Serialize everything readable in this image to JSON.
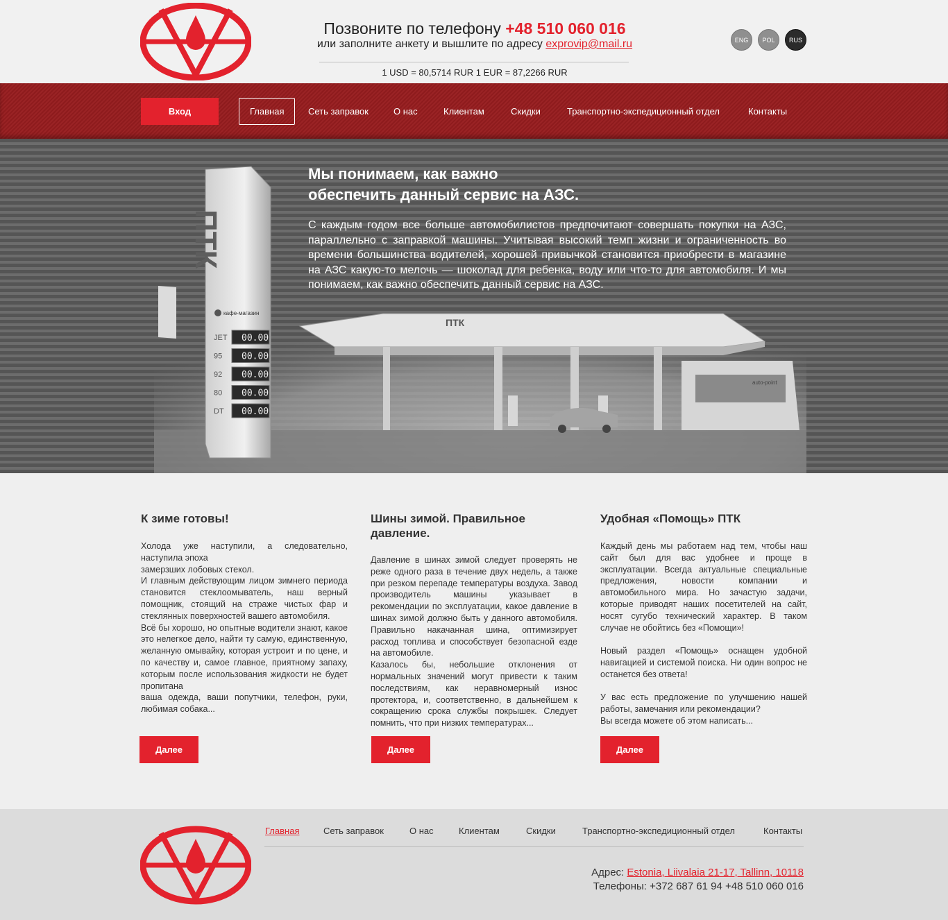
{
  "header": {
    "phone_prefix": "Позвоните по телефону",
    "phone": "+48 510 060 016",
    "mail_prefix": "или заполните анкету и вышлите по адресу",
    "email": "exprovip@mail.ru",
    "rates": "1 USD = 80,5714 RUR 1 EUR = 87,2266 RUR",
    "languages": [
      "ENG",
      "POL",
      "RUS"
    ]
  },
  "nav": {
    "login": "Вход",
    "items": [
      "Главная",
      "Сеть заправок",
      "О нас",
      "Клиентам",
      "Скидки",
      "Транспортно-экспедиционный отдел",
      "Контакты"
    ]
  },
  "hero": {
    "title": "Мы понимаем, как важно\nобеспечить данный сервис на АЗС.",
    "text": "С каждым годом все больше автомобилистов предпочитают совершать покупки на АЗС, параллельно с заправкой машины. Учитывая высокий темп жизни и ограниченность во времени большинства водителей, хорошей привычкой становится приобрести в магазине на АЗС какую-то мелочь — шоколад для ребенка, воду или что-то для автомобиля. И мы понимаем, как важно обеспечить данный сервис на АЗС.",
    "pylon": {
      "brand": "ПТК",
      "cafe": "кафе-магазин",
      "prices": [
        {
          "grade": "JET",
          "price": "00.00"
        },
        {
          "grade": "95",
          "price": "00.00"
        },
        {
          "grade": "92",
          "price": "00.00"
        },
        {
          "grade": "80",
          "price": "00.00"
        },
        {
          "grade": "DT",
          "price": "00.00"
        }
      ]
    },
    "canopy_brand": "ПТК",
    "shop_sign": "auto-point"
  },
  "articles": [
    {
      "title": "К зиме готовы!",
      "body": "Холода уже наступили, а следовательно, наступила эпоха\nзамерзших лобовых стекол.\nИ главным действующим лицом зимнего периода становится стеклоомыватель, наш верный помощник, стоящий на страже чистых фар и стеклянных поверхностей вашего автомобиля.\nВсё бы хорошо, но опытные водители знают, какое это нелегкое дело, найти ту самую, единственную, желанную омывайку, которая устроит и по цене, и по качеству и, самое главное, приятному запаху, которым после использования жидкости не будет пропитана\nваша одежда, ваши попутчики, телефон, руки, любимая собака...",
      "more": "Далее"
    },
    {
      "title": "Шины зимой. Правильное давление.",
      "body": "Давление в шинах зимой следует проверять не реже одного раза в течение двух недель, а также при резком перепаде температуры воздуха. Завод производитель машины указывает в рекомендации по эксплуатации, какое давление в шинах зимой должно быть у данного автомобиля. Правильно накачанная шина, оптимизирует расход топлива и способствует безопасной езде на автомобиле.\nКазалось бы, небольшие отклонения от нормальных значений могут привести к таким последствиям, как неравномерный износ протектора, и, соответственно, в дальнейшем к сокращению срока службы покрышек. Следует помнить, что при низких температурах...",
      "more": "Далее"
    },
    {
      "title": "Удобная «Помощь» ПТК",
      "body": "Каждый день мы работаем над тем, чтобы наш сайт был для вас  удобнее и проще в эксплуатации. Всегда актуальные специальные предложения, новости компании и автомобильного мира.  Но зачастую задачи, которые приводят наших посетителей на сайт, носят сугубо технический характер. В таком случае не обойтись без «Помощи»!\n\nНовый раздел «Помощь» оснащен удобной навигацией и системой поиска. Ни один вопрос не останется без ответа!\n\nУ вас есть предложение по улучшению нашей работы, замечания или рекомендации?\nВы всегда можете об этом написать...",
      "more": "Далее"
    }
  ],
  "footer": {
    "nav": [
      "Главная",
      "Сеть заправок",
      "О нас",
      "Клиентам",
      "Скидки",
      "Транспортно-экспедиционный отдел",
      "Контакты"
    ],
    "address_label": "Адрес:",
    "address": "Estonia, Liivalaia 21-17, Tallinn, 10118",
    "phones_label": "Телефоны:",
    "phones": "+372 687 61 94  +48 510 060 016"
  },
  "colors": {
    "accent": "#e3222d",
    "nav_bg": "#8e1b1d",
    "dark": "#2b2b2b"
  }
}
